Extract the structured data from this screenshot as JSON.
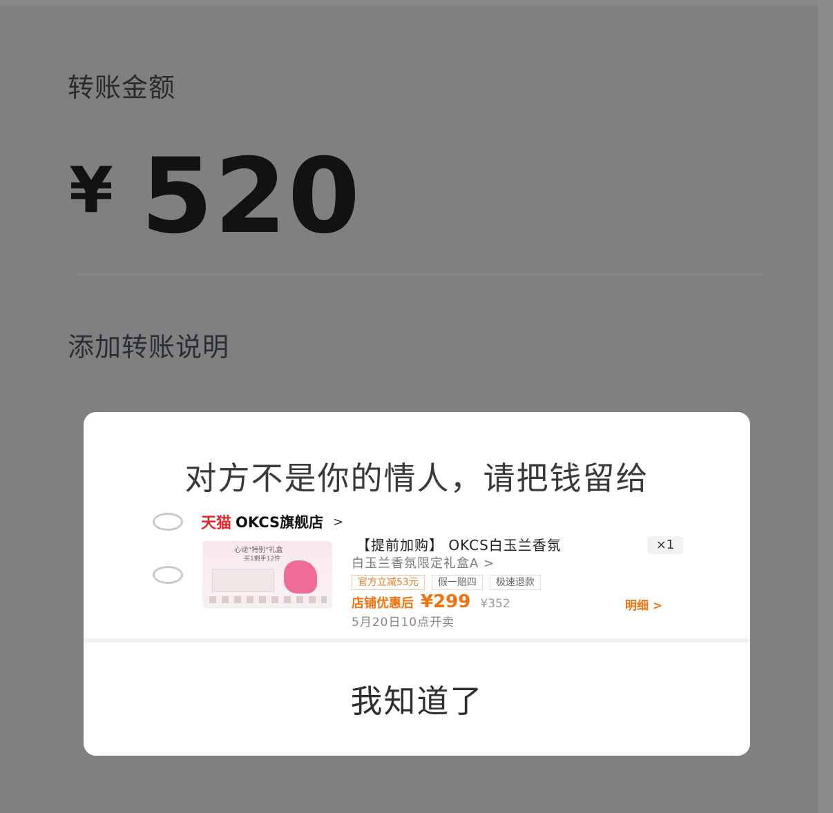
{
  "transfer": {
    "amount_label": "转账金额",
    "currency": "¥",
    "amount": "520",
    "add_note": "添加转账说明"
  },
  "dialog": {
    "title": "对方不是你的情人，请把钱留给",
    "store": {
      "platform": "天猫",
      "name": "OKCS旗舰店",
      "chevron": ">"
    },
    "product": {
      "thumb_line1": "心动“特别”礼盒",
      "thumb_line2": "买1剩手12件",
      "title": "【提前加购】 OKCS白玉兰香氛",
      "subtitle": "白玉兰香氛限定礼盒A >",
      "quantity": "×1",
      "tags": [
        "官方立减53元",
        "假一赔四",
        "极速退款"
      ],
      "price_label": "店铺优惠后",
      "price": "¥299",
      "original_price": "¥352",
      "detail_link": "明细 >",
      "sale_time": "5月20日10点开卖"
    },
    "confirm_button": "我知道了"
  },
  "colors": {
    "backdrop": "#808081",
    "tmall_red": "#e8262c",
    "price_orange": "#f4710c"
  }
}
